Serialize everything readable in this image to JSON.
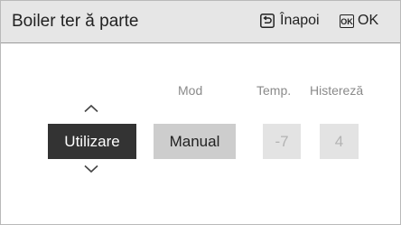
{
  "header": {
    "title": "Boiler ter ă parte",
    "back_label": "Înapoi",
    "ok_icon_text": "OK",
    "ok_label": "OK"
  },
  "columns": {
    "mod_label": "Mod",
    "temp_label": "Temp.",
    "hist_label": "Histereză"
  },
  "controls": {
    "use_value": "Utilizare",
    "mode_value": "Manual",
    "temp_value": "-7",
    "hist_value": "4"
  },
  "icons": {
    "back": "return-arrow-icon",
    "ok": "ok-key-icon",
    "up": "chevron-up-icon",
    "down": "chevron-down-icon"
  },
  "colors": {
    "header_bg": "#e6e6e6",
    "selected_bg": "#333333",
    "active_bg": "#cdcdcd",
    "disabled_bg": "#e3e3e3"
  }
}
